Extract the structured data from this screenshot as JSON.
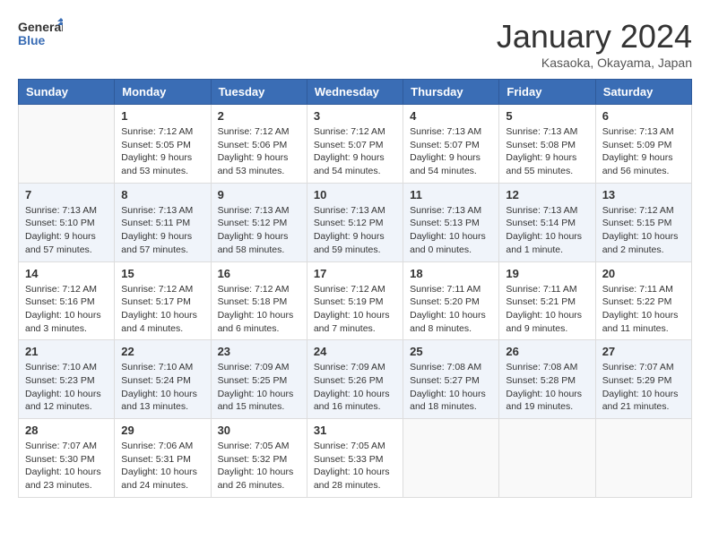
{
  "header": {
    "logo_line1": "General",
    "logo_line2": "Blue",
    "month": "January 2024",
    "location": "Kasaoka, Okayama, Japan"
  },
  "weekdays": [
    "Sunday",
    "Monday",
    "Tuesday",
    "Wednesday",
    "Thursday",
    "Friday",
    "Saturday"
  ],
  "weeks": [
    [
      {
        "day": "",
        "info": ""
      },
      {
        "day": "1",
        "info": "Sunrise: 7:12 AM\nSunset: 5:05 PM\nDaylight: 9 hours\nand 53 minutes."
      },
      {
        "day": "2",
        "info": "Sunrise: 7:12 AM\nSunset: 5:06 PM\nDaylight: 9 hours\nand 53 minutes."
      },
      {
        "day": "3",
        "info": "Sunrise: 7:12 AM\nSunset: 5:07 PM\nDaylight: 9 hours\nand 54 minutes."
      },
      {
        "day": "4",
        "info": "Sunrise: 7:13 AM\nSunset: 5:07 PM\nDaylight: 9 hours\nand 54 minutes."
      },
      {
        "day": "5",
        "info": "Sunrise: 7:13 AM\nSunset: 5:08 PM\nDaylight: 9 hours\nand 55 minutes."
      },
      {
        "day": "6",
        "info": "Sunrise: 7:13 AM\nSunset: 5:09 PM\nDaylight: 9 hours\nand 56 minutes."
      }
    ],
    [
      {
        "day": "7",
        "info": "Sunrise: 7:13 AM\nSunset: 5:10 PM\nDaylight: 9 hours\nand 57 minutes."
      },
      {
        "day": "8",
        "info": "Sunrise: 7:13 AM\nSunset: 5:11 PM\nDaylight: 9 hours\nand 57 minutes."
      },
      {
        "day": "9",
        "info": "Sunrise: 7:13 AM\nSunset: 5:12 PM\nDaylight: 9 hours\nand 58 minutes."
      },
      {
        "day": "10",
        "info": "Sunrise: 7:13 AM\nSunset: 5:12 PM\nDaylight: 9 hours\nand 59 minutes."
      },
      {
        "day": "11",
        "info": "Sunrise: 7:13 AM\nSunset: 5:13 PM\nDaylight: 10 hours\nand 0 minutes."
      },
      {
        "day": "12",
        "info": "Sunrise: 7:13 AM\nSunset: 5:14 PM\nDaylight: 10 hours\nand 1 minute."
      },
      {
        "day": "13",
        "info": "Sunrise: 7:12 AM\nSunset: 5:15 PM\nDaylight: 10 hours\nand 2 minutes."
      }
    ],
    [
      {
        "day": "14",
        "info": "Sunrise: 7:12 AM\nSunset: 5:16 PM\nDaylight: 10 hours\nand 3 minutes."
      },
      {
        "day": "15",
        "info": "Sunrise: 7:12 AM\nSunset: 5:17 PM\nDaylight: 10 hours\nand 4 minutes."
      },
      {
        "day": "16",
        "info": "Sunrise: 7:12 AM\nSunset: 5:18 PM\nDaylight: 10 hours\nand 6 minutes."
      },
      {
        "day": "17",
        "info": "Sunrise: 7:12 AM\nSunset: 5:19 PM\nDaylight: 10 hours\nand 7 minutes."
      },
      {
        "day": "18",
        "info": "Sunrise: 7:11 AM\nSunset: 5:20 PM\nDaylight: 10 hours\nand 8 minutes."
      },
      {
        "day": "19",
        "info": "Sunrise: 7:11 AM\nSunset: 5:21 PM\nDaylight: 10 hours\nand 9 minutes."
      },
      {
        "day": "20",
        "info": "Sunrise: 7:11 AM\nSunset: 5:22 PM\nDaylight: 10 hours\nand 11 minutes."
      }
    ],
    [
      {
        "day": "21",
        "info": "Sunrise: 7:10 AM\nSunset: 5:23 PM\nDaylight: 10 hours\nand 12 minutes."
      },
      {
        "day": "22",
        "info": "Sunrise: 7:10 AM\nSunset: 5:24 PM\nDaylight: 10 hours\nand 13 minutes."
      },
      {
        "day": "23",
        "info": "Sunrise: 7:09 AM\nSunset: 5:25 PM\nDaylight: 10 hours\nand 15 minutes."
      },
      {
        "day": "24",
        "info": "Sunrise: 7:09 AM\nSunset: 5:26 PM\nDaylight: 10 hours\nand 16 minutes."
      },
      {
        "day": "25",
        "info": "Sunrise: 7:08 AM\nSunset: 5:27 PM\nDaylight: 10 hours\nand 18 minutes."
      },
      {
        "day": "26",
        "info": "Sunrise: 7:08 AM\nSunset: 5:28 PM\nDaylight: 10 hours\nand 19 minutes."
      },
      {
        "day": "27",
        "info": "Sunrise: 7:07 AM\nSunset: 5:29 PM\nDaylight: 10 hours\nand 21 minutes."
      }
    ],
    [
      {
        "day": "28",
        "info": "Sunrise: 7:07 AM\nSunset: 5:30 PM\nDaylight: 10 hours\nand 23 minutes."
      },
      {
        "day": "29",
        "info": "Sunrise: 7:06 AM\nSunset: 5:31 PM\nDaylight: 10 hours\nand 24 minutes."
      },
      {
        "day": "30",
        "info": "Sunrise: 7:05 AM\nSunset: 5:32 PM\nDaylight: 10 hours\nand 26 minutes."
      },
      {
        "day": "31",
        "info": "Sunrise: 7:05 AM\nSunset: 5:33 PM\nDaylight: 10 hours\nand 28 minutes."
      },
      {
        "day": "",
        "info": ""
      },
      {
        "day": "",
        "info": ""
      },
      {
        "day": "",
        "info": ""
      }
    ]
  ]
}
